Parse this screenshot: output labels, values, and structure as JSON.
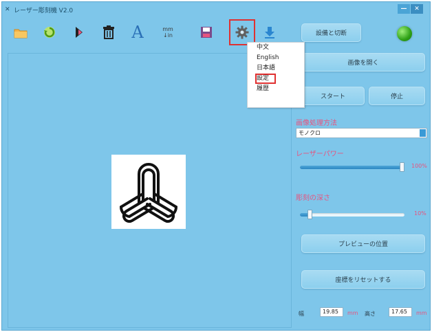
{
  "window": {
    "title": "レーザー彫刻機 V2.0",
    "controls": {
      "minimize": "—",
      "close": "✕"
    }
  },
  "toolbar": {
    "tools": [
      {
        "name": "open-folder-icon"
      },
      {
        "name": "rotate-icon"
      },
      {
        "name": "flip-icon"
      },
      {
        "name": "delete-icon"
      },
      {
        "name": "text-icon",
        "label": "A"
      },
      {
        "name": "unit-toggle-icon",
        "label_top": "mm",
        "label_bottom": "↓in"
      },
      {
        "name": "save-icon"
      },
      {
        "name": "settings-icon"
      },
      {
        "name": "download-icon"
      }
    ]
  },
  "menu": {
    "items": [
      "中文",
      "English",
      "日本語",
      "設定",
      "履歴"
    ]
  },
  "sidebar": {
    "connect_label": "設備と切断",
    "open_image_label": "画像を開く",
    "start_label": "スタート",
    "stop_label": "停止",
    "process_label": "画像処理方法",
    "process_value": "モノクロ",
    "laser_power_label": "レーザーパワー",
    "laser_power_value": 100,
    "laser_power_text": "100%",
    "depth_label": "彫刻の深さ",
    "depth_value": 10,
    "depth_text": "10%",
    "preview_position_label": "プレビューの位置",
    "reset_coords_label": "座標をリセットする"
  },
  "dimensions": {
    "width_label": "幅",
    "width_value": "19.85",
    "width_unit": "mm",
    "height_label": "高さ",
    "height_value": "17.65",
    "height_unit": "mm"
  },
  "colors": {
    "background": "#7ec6ea",
    "accent_red": "#e03030",
    "status_green": "#2ea016",
    "label_pink": "#e7547f"
  }
}
